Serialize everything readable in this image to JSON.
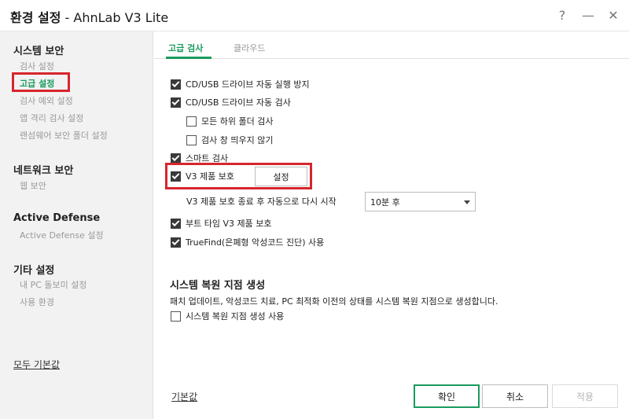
{
  "window": {
    "title_bold": "환경 설정",
    "title_rest": " - AhnLab V3 Lite",
    "help_glyph": "?",
    "minimize_glyph": "—",
    "close_glyph": "✕"
  },
  "sidebar": {
    "sections": [
      {
        "label": "시스템 보안",
        "items": [
          "검사 설정",
          "고급 설정",
          "검사 예외 설정",
          "앱 격리 검사 설정",
          "랜섬웨어 보안 폴더 설정"
        ]
      },
      {
        "label": "네트워크 보안",
        "items": [
          "웹 보안"
        ]
      },
      {
        "label": "Active Defense",
        "items": [
          "Active Defense 설정"
        ]
      },
      {
        "label": "기타 설정",
        "items": [
          "내 PC 돌보미 설정",
          "사용 환경"
        ]
      }
    ],
    "active_item": "고급 설정",
    "reset_all": "모두 기본값"
  },
  "tabs": [
    {
      "label": "고급 검사",
      "active": true
    },
    {
      "label": "클라우드",
      "active": false
    }
  ],
  "options": {
    "cd_autorun_block": {
      "label": "CD/USB 드라이브 자동 실행 방지",
      "checked": true
    },
    "cd_autoscan": {
      "label": "CD/USB 드라이브 자동 검사",
      "checked": true
    },
    "all_subfolders": {
      "label": "모든 하위 폴더 검사",
      "checked": false
    },
    "no_scan_window": {
      "label": "검사 창 띄우지 않기",
      "checked": false
    },
    "smart_scan": {
      "label": "스마트 검사",
      "checked": true
    },
    "v3_protect": {
      "label": "V3 제품 보호",
      "checked": true
    },
    "boot_time_protect": {
      "label": "부트 타임 V3 제품 보호",
      "checked": true
    },
    "truefind": {
      "label": "TrueFind(은폐형 악성코드 진단) 사용",
      "checked": true
    },
    "restore_point_use": {
      "label": "시스템 복원 지점 생성 사용",
      "checked": false
    }
  },
  "setting_button": "설정",
  "restart": {
    "label": "V3 제품 보호 종료 후 자동으로 다시 시작",
    "selected": "10분 후"
  },
  "restore_section": {
    "title": "시스템 복원 지점 생성",
    "description": "패치 업데이트, 악성코드 치료, PC 최적화 이전의 상태를 시스템 복원 지점으로 생성합니다."
  },
  "footer": {
    "reset": "기본값",
    "ok": "확인",
    "cancel": "취소",
    "apply": "적용"
  },
  "colors": {
    "accent": "#1a9b5e",
    "highlight": "#d7252d"
  }
}
